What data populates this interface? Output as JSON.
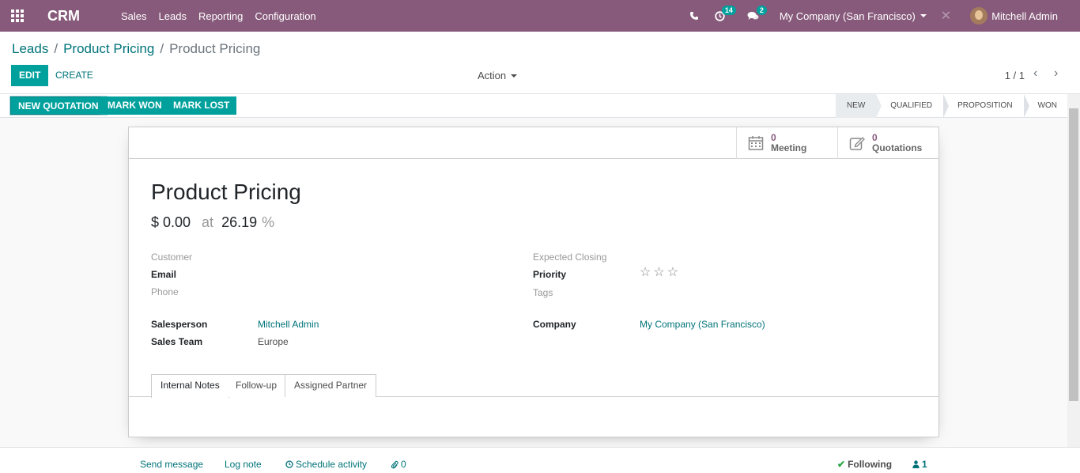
{
  "navbar": {
    "app_name": "CRM",
    "menu": [
      "Sales",
      "Leads",
      "Reporting",
      "Configuration"
    ],
    "activity_count": "14",
    "message_count": "2",
    "company": "My Company (San Francisco)",
    "user": "Mitchell Admin",
    "color": "#875a7b"
  },
  "breadcrumb": [
    "Leads",
    "Product Pricing",
    "Product Pricing"
  ],
  "control": {
    "edit_label": "EDIT",
    "create_label": "CREATE",
    "action_label": "Action",
    "pager": "1 / 1"
  },
  "statusbar": {
    "buttons": [
      "NEW QUOTATION",
      "MARK WON",
      "MARK LOST"
    ],
    "stages": [
      "NEW",
      "QUALIFIED",
      "PROPOSITION",
      "WON"
    ],
    "current_stage": "NEW"
  },
  "smart_buttons": [
    {
      "count": "0",
      "label": "Meeting",
      "icon": "calendar-icon"
    },
    {
      "count": "0",
      "label": "Quotations",
      "icon": "edit-icon"
    }
  ],
  "lead": {
    "name": "Product Pricing",
    "revenue": "$ 0.00",
    "at": "at",
    "probability": "26.19",
    "percent": "%"
  },
  "fields": {
    "customer": "Customer",
    "email": "Email",
    "phone": "Phone",
    "salesperson_label": "Salesperson",
    "salesperson_value": "Mitchell Admin",
    "sales_team_label": "Sales Team",
    "sales_team_value": "Europe",
    "expected_closing": "Expected Closing",
    "priority": "Priority",
    "priority_stars": 0,
    "tags": "Tags",
    "company_label": "Company",
    "company_value": "My Company (San Francisco)"
  },
  "tabs": [
    "Internal Notes",
    "Follow-up",
    "Assigned Partner"
  ],
  "chatter": {
    "send_message": "Send message",
    "log_note": "Log note",
    "schedule_activity": "Schedule activity",
    "attachments": "0",
    "following": "Following",
    "followers": "1"
  },
  "colors": {
    "primary": "#00a09d",
    "link": "#00737a"
  }
}
